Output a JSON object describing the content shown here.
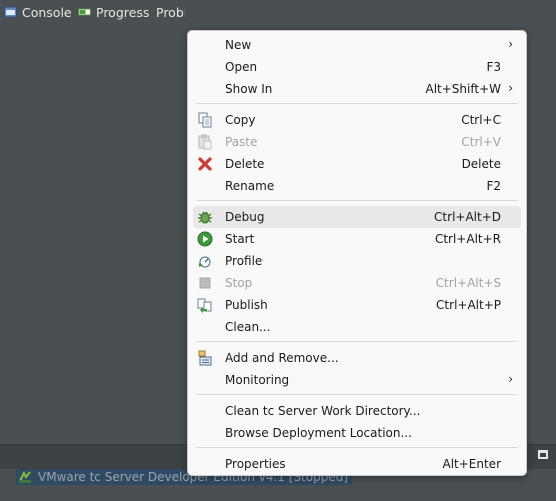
{
  "bottom_tabs": {
    "console": "Console",
    "progress": "Progress",
    "problems": "Problems"
  },
  "server_row": "VMware tc Server Developer Edition v4.1  [Stopped]",
  "menu": {
    "new": {
      "label": "New"
    },
    "open": {
      "label": "Open",
      "shortcut": "F3"
    },
    "show_in": {
      "label": "Show In",
      "shortcut": "Alt+Shift+W"
    },
    "copy": {
      "label": "Copy",
      "shortcut": "Ctrl+C"
    },
    "paste": {
      "label": "Paste",
      "shortcut": "Ctrl+V"
    },
    "delete": {
      "label": "Delete",
      "shortcut": "Delete"
    },
    "rename": {
      "label": "Rename",
      "shortcut": "F2"
    },
    "debug": {
      "label": "Debug",
      "shortcut": "Ctrl+Alt+D"
    },
    "start": {
      "label": "Start",
      "shortcut": "Ctrl+Alt+R"
    },
    "profile": {
      "label": "Profile"
    },
    "stop": {
      "label": "Stop",
      "shortcut": "Ctrl+Alt+S"
    },
    "publish": {
      "label": "Publish",
      "shortcut": "Ctrl+Alt+P"
    },
    "clean": {
      "label": "Clean..."
    },
    "add_remove": {
      "label": "Add and Remove..."
    },
    "monitoring": {
      "label": "Monitoring"
    },
    "clean_work_dir": {
      "label": "Clean tc Server Work Directory..."
    },
    "browse_deploy": {
      "label": "Browse Deployment Location..."
    },
    "properties": {
      "label": "Properties",
      "shortcut": "Alt+Enter"
    }
  }
}
